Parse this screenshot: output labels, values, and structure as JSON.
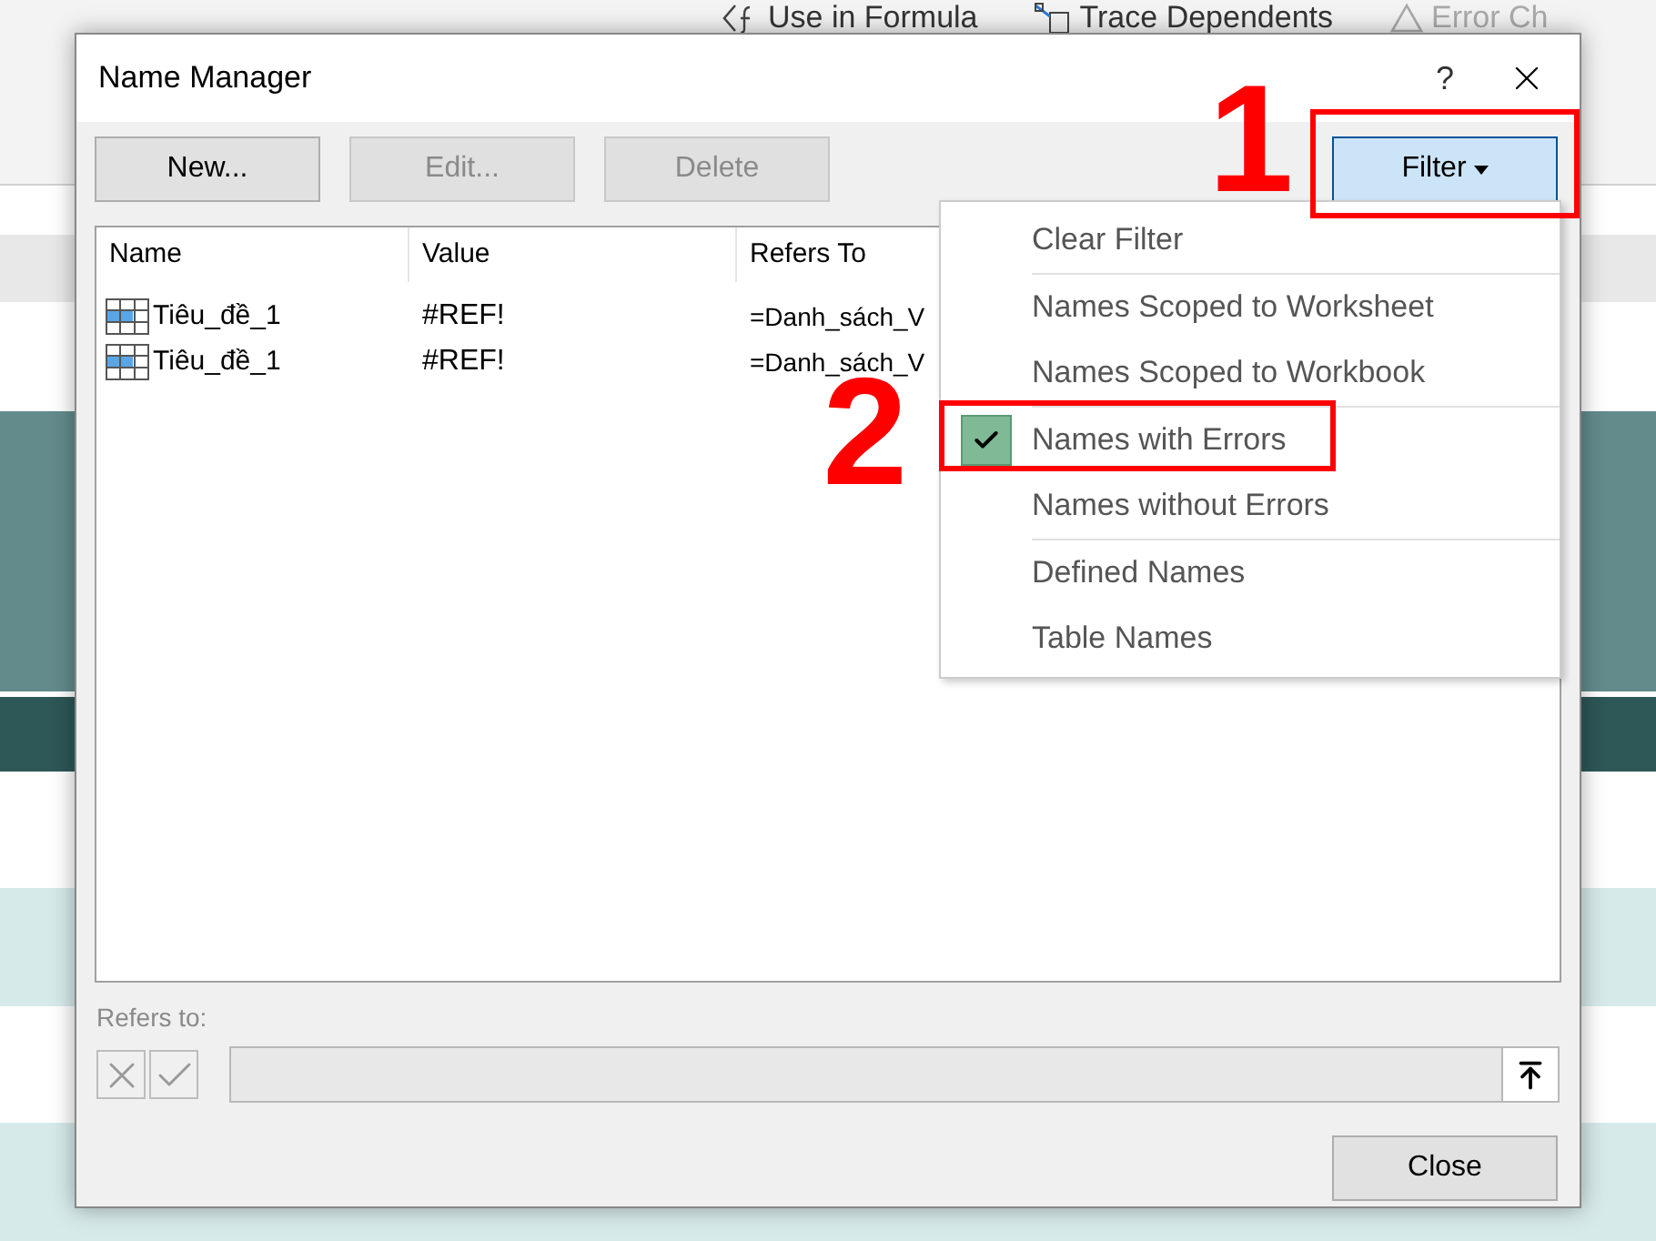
{
  "background": {
    "ribbon": [
      {
        "kind": "formula",
        "label": "Use in Formula"
      },
      {
        "kind": "trace",
        "label": "Trace Dependents"
      },
      {
        "kind": "error",
        "label": "Error Ch"
      }
    ],
    "sheet_rows": [
      {
        "kind": "plain"
      },
      {
        "kind": "shaded"
      },
      {
        "kind": "plain"
      },
      {
        "kind": "shaded"
      }
    ]
  },
  "dialog": {
    "title": "Name Manager",
    "help": "?",
    "buttons": [
      {
        "label": "New...",
        "disabled": false
      },
      {
        "label": "Edit...",
        "disabled": true
      },
      {
        "label": "Delete",
        "disabled": true
      }
    ],
    "filter_button": {
      "label": "Filter",
      "expanded": true
    },
    "columns": [
      "Name",
      "Value",
      "Refers To"
    ],
    "rows": [
      {
        "name": "Tiêu_đề_1",
        "value": "#REF!",
        "refers_to": "=Danh_sách_V"
      },
      {
        "name": "Tiêu_đề_1",
        "value": "#REF!",
        "refers_to": "=Danh_sách_V"
      }
    ],
    "filter_menu": [
      [
        {
          "label": "Clear Filter",
          "checked": false
        }
      ],
      [
        {
          "label": "Names Scoped to Worksheet",
          "checked": false
        },
        {
          "label": "Names Scoped to Workbook",
          "checked": false
        }
      ],
      [
        {
          "label": "Names with Errors",
          "checked": true
        },
        {
          "label": "Names without Errors",
          "checked": false
        }
      ],
      [
        {
          "label": "Defined Names",
          "checked": false
        },
        {
          "label": "Table Names",
          "checked": false
        }
      ]
    ],
    "refers_to_label": "Refers to:",
    "close_button": "Close"
  },
  "annotations": [
    "1",
    "2"
  ]
}
